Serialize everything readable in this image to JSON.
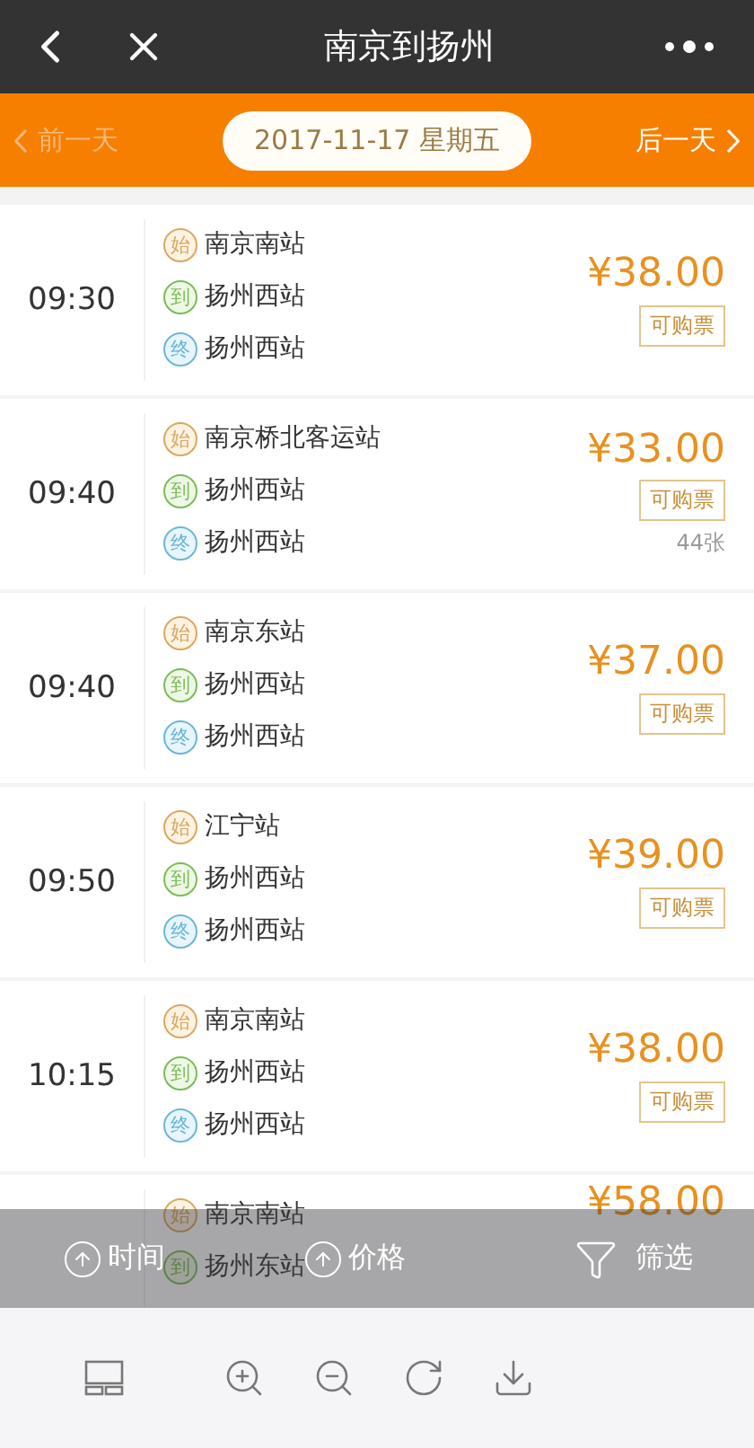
{
  "header": {
    "title": "南京到扬州"
  },
  "date_bar": {
    "prev": {
      "label": "前一天",
      "disabled": true
    },
    "date": "2017-11-17 星期五",
    "next": {
      "label": "后一天",
      "disabled": false
    }
  },
  "trips": [
    {
      "time": "09:30",
      "stations": [
        {
          "kind": "start",
          "mark": "始",
          "name": "南京南站"
        },
        {
          "kind": "arrive",
          "mark": "到",
          "name": "扬州西站"
        },
        {
          "kind": "end",
          "mark": "终",
          "name": "扬州西站"
        }
      ],
      "price": "¥38.00",
      "status": "可购票"
    },
    {
      "time": "09:40",
      "stations": [
        {
          "kind": "start",
          "mark": "始",
          "name": "南京桥北客运站"
        },
        {
          "kind": "arrive",
          "mark": "到",
          "name": "扬州西站"
        },
        {
          "kind": "end",
          "mark": "终",
          "name": "扬州西站"
        }
      ],
      "price": "¥33.00",
      "status": "可购票",
      "remaining": "44张"
    },
    {
      "time": "09:40",
      "stations": [
        {
          "kind": "start",
          "mark": "始",
          "name": "南京东站"
        },
        {
          "kind": "arrive",
          "mark": "到",
          "name": "扬州西站"
        },
        {
          "kind": "end",
          "mark": "终",
          "name": "扬州西站"
        }
      ],
      "price": "¥37.00",
      "status": "可购票"
    },
    {
      "time": "09:50",
      "stations": [
        {
          "kind": "start",
          "mark": "始",
          "name": "江宁站"
        },
        {
          "kind": "arrive",
          "mark": "到",
          "name": "扬州西站"
        },
        {
          "kind": "end",
          "mark": "终",
          "name": "扬州西站"
        }
      ],
      "price": "¥39.00",
      "status": "可购票"
    },
    {
      "time": "10:15",
      "stations": [
        {
          "kind": "start",
          "mark": "始",
          "name": "南京南站"
        },
        {
          "kind": "arrive",
          "mark": "到",
          "name": "扬州西站"
        },
        {
          "kind": "end",
          "mark": "终",
          "name": "扬州西站"
        }
      ],
      "price": "¥38.00",
      "status": "可购票"
    },
    {
      "stations": [
        {
          "kind": "start",
          "mark": "始",
          "name": "南京南站"
        },
        {
          "kind": "arrive",
          "mark": "到",
          "name": "扬州东站"
        }
      ],
      "price": "¥58.00"
    }
  ],
  "sort_bar": [
    {
      "kind": "sort",
      "label": "时间"
    },
    {
      "kind": "sort",
      "label": "价格"
    },
    {
      "kind": "filter",
      "label": "筛选"
    }
  ]
}
